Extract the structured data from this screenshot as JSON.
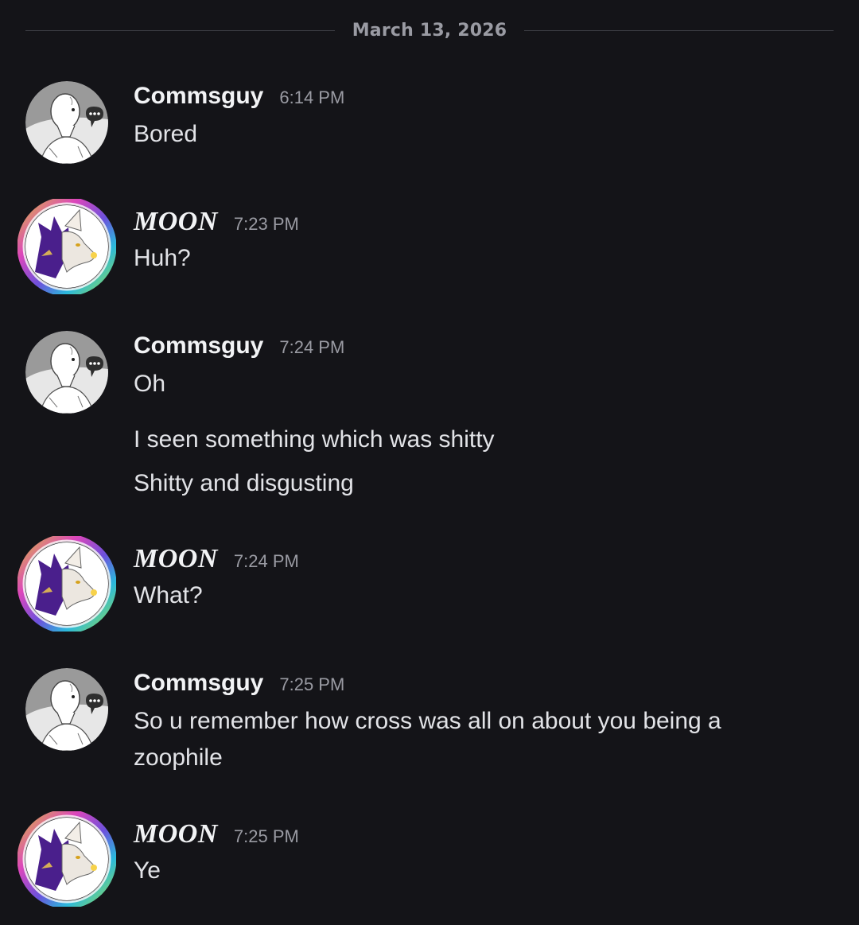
{
  "date_divider": "March 13, 2026",
  "messages": [
    {
      "author": "Commsguy",
      "avatar": "sketch-figure-avatar",
      "time": "6:14 PM",
      "lines": [
        "Bored"
      ]
    },
    {
      "author": "MOON",
      "avatar": "purple-wolf-avatar",
      "time": "7:23 PM",
      "lines": [
        "Huh?"
      ]
    },
    {
      "author": "Commsguy",
      "avatar": "sketch-figure-avatar",
      "time": "7:24 PM",
      "lines": [
        "Oh",
        "I seen something which was shitty",
        "Shitty and disgusting"
      ]
    },
    {
      "author": "MOON",
      "avatar": "purple-wolf-avatar",
      "time": "7:24 PM",
      "lines": [
        "What?"
      ]
    },
    {
      "author": "Commsguy",
      "avatar": "sketch-figure-avatar",
      "time": "7:25 PM",
      "lines": [
        "So u remember how cross was all on about you being a",
        "zoophile"
      ]
    },
    {
      "author": "MOON",
      "avatar": "purple-wolf-avatar",
      "time": "7:25 PM",
      "lines": [
        "Ye"
      ]
    }
  ],
  "colors": {
    "background": "#141418",
    "text": "#e2e3e7",
    "muted": "#9a9ba3",
    "divider": "#3c3d44",
    "moon_purple": "#4a1f8c"
  }
}
